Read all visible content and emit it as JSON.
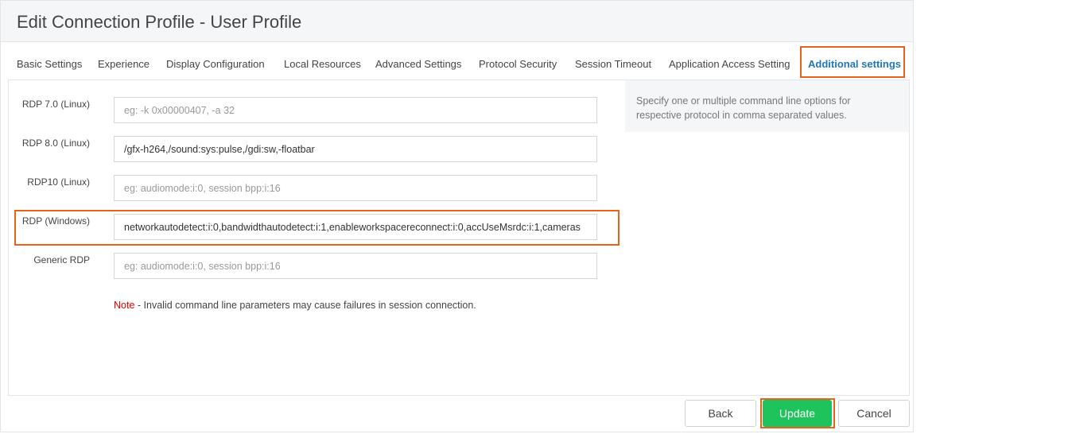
{
  "header": {
    "title": "Edit Connection Profile - User Profile"
  },
  "tabs": [
    {
      "label": "Basic Settings"
    },
    {
      "label": "Experience"
    },
    {
      "label": "Display Configuration"
    },
    {
      "label": "Local Resources"
    },
    {
      "label": "Advanced Settings"
    },
    {
      "label": "Protocol Security"
    },
    {
      "label": "Session Timeout"
    },
    {
      "label": "Application Access Setting"
    },
    {
      "label": "Additional settings",
      "active": true
    }
  ],
  "fields": {
    "rdp7": {
      "label": "RDP 7.0 (Linux)",
      "value": "",
      "placeholder": "eg: -k 0x00000407, -a 32"
    },
    "rdp8": {
      "label": "RDP 8.0 (Linux)",
      "value": "/gfx-h264,/sound:sys:pulse,/gdi:sw,-floatbar",
      "placeholder": ""
    },
    "rdp10": {
      "label": "RDP10 (Linux)",
      "value": "",
      "placeholder": "eg: audiomode:i:0, session bpp:i:16"
    },
    "rdpwin": {
      "label": "RDP (Windows)",
      "value": "networkautodetect:i:0,bandwidthautodetect:i:1,enableworkspacereconnect:i:0,accUseMsrdc:i:1,cameras",
      "placeholder": ""
    },
    "generic": {
      "label": "Generic RDP",
      "value": "",
      "placeholder": "eg: audiomode:i:0, session bpp:i:16"
    }
  },
  "note": {
    "prefix": "Note",
    "text": " - Invalid command line parameters may cause failures in session connection."
  },
  "help": {
    "text": "Specify one or multiple command line options for respective protocol in comma separated values."
  },
  "buttons": {
    "back": "Back",
    "update": "Update",
    "cancel": "Cancel"
  },
  "colors": {
    "accent": "#1f78b4",
    "highlight": "#e8631a",
    "update": "#1ec35c",
    "note": "#e00000"
  }
}
